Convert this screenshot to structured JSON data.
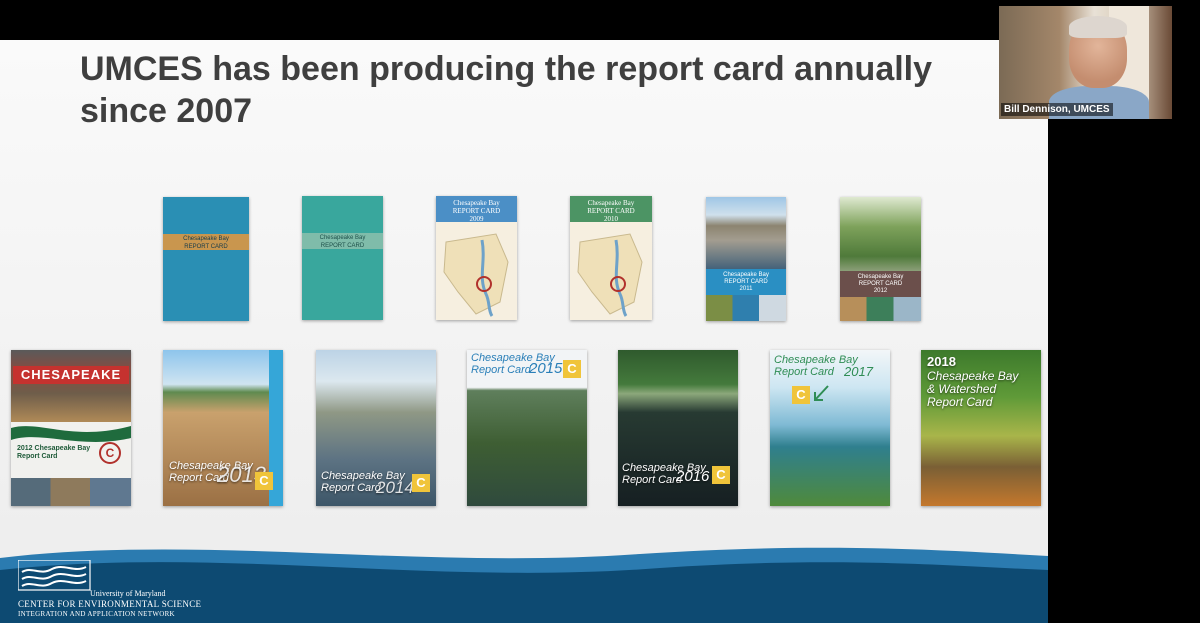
{
  "slide": {
    "title": "UMCES has been producing the report card annually since 2007"
  },
  "covers_top": [
    {
      "id": "c2007",
      "title": "Chesapeake Bay",
      "subtitle": "REPORT CARD"
    },
    {
      "id": "c2008",
      "title": "Chesapeake Bay",
      "subtitle": "REPORT CARD"
    },
    {
      "id": "c2009",
      "title": "Chesapeake Bay",
      "subtitle": "REPORT CARD",
      "year": "2009"
    },
    {
      "id": "c2010",
      "title": "Chesapeake Bay",
      "subtitle": "REPORT CARD",
      "year": "2010"
    },
    {
      "id": "c2011",
      "title": "Chesapeake Bay",
      "subtitle": "REPORT CARD",
      "year": "2011"
    },
    {
      "id": "c2012a",
      "title": "Chesapeake Bay",
      "subtitle": "REPORT CARD",
      "year": "2012"
    }
  ],
  "covers_bottom": {
    "c2012": {
      "sign": "CHESAPEAKE",
      "title_line1": "2012 Chesapeake Bay",
      "title_line2": "Report Card",
      "logo": "C"
    },
    "c2013": {
      "title_line1": "Chesapeake Bay",
      "title_line2": "Report Card",
      "year": "2013",
      "badge": "C"
    },
    "c2014": {
      "title_line1": "Chesapeake Bay",
      "title_line2": "Report Card",
      "year": "2014",
      "badge": "C"
    },
    "c2015": {
      "title_line1": "Chesapeake Bay",
      "title_line2": "Report Card",
      "year": "2015",
      "badge": "C"
    },
    "c2016": {
      "title_line1": "Chesapeake Bay",
      "title_line2": "Report Card",
      "year": "2016",
      "badge": "C"
    },
    "c2017": {
      "title_line1": "Chesapeake Bay",
      "title_line2": "Report Card",
      "year": "2017",
      "badge": "C"
    },
    "c2018": {
      "year": "2018",
      "title_line1": "Chesapeake Bay",
      "title_line2": "& Watershed",
      "title_line3": "Report Card"
    }
  },
  "footer": {
    "org_line1": "University of Maryland",
    "org_line2": "CENTER FOR ENVIRONMENTAL SCIENCE",
    "org_line3": "INTEGRATION AND APPLICATION NETWORK"
  },
  "webcam": {
    "participant_name": "Bill Dennison, UMCES"
  },
  "colors": {
    "title_text": "#3f3f3f",
    "wave_dark": "#0d4a72",
    "wave_light": "#2b7bb0",
    "badge_yellow": "#f0c43a"
  }
}
